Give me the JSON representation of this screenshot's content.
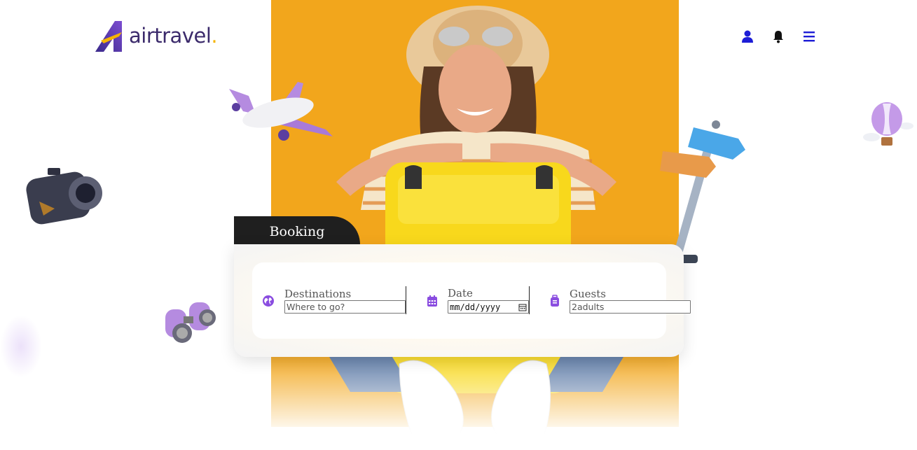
{
  "brand": {
    "name": "airtravel",
    "dot": "."
  },
  "header": {
    "icons": [
      "user-icon",
      "bell-icon",
      "menu-icon"
    ],
    "accent": "#1d1dd6"
  },
  "booking": {
    "tab_label": "Booking",
    "fields": {
      "destinations": {
        "label": "Destinations",
        "placeholder": "Where to go?",
        "icon": "globe-icon"
      },
      "date": {
        "label": "Date",
        "value": "mm/dd/yyyy",
        "icon": "calendar-icon"
      },
      "guests": {
        "label": "Guests",
        "placeholder": "2adults",
        "icon": "luggage-icon"
      }
    },
    "accent": "#8a4de0"
  },
  "colors": {
    "hero": "#f2a61c",
    "tab": "#1f1f1f",
    "logo": "#3b2a6b"
  }
}
